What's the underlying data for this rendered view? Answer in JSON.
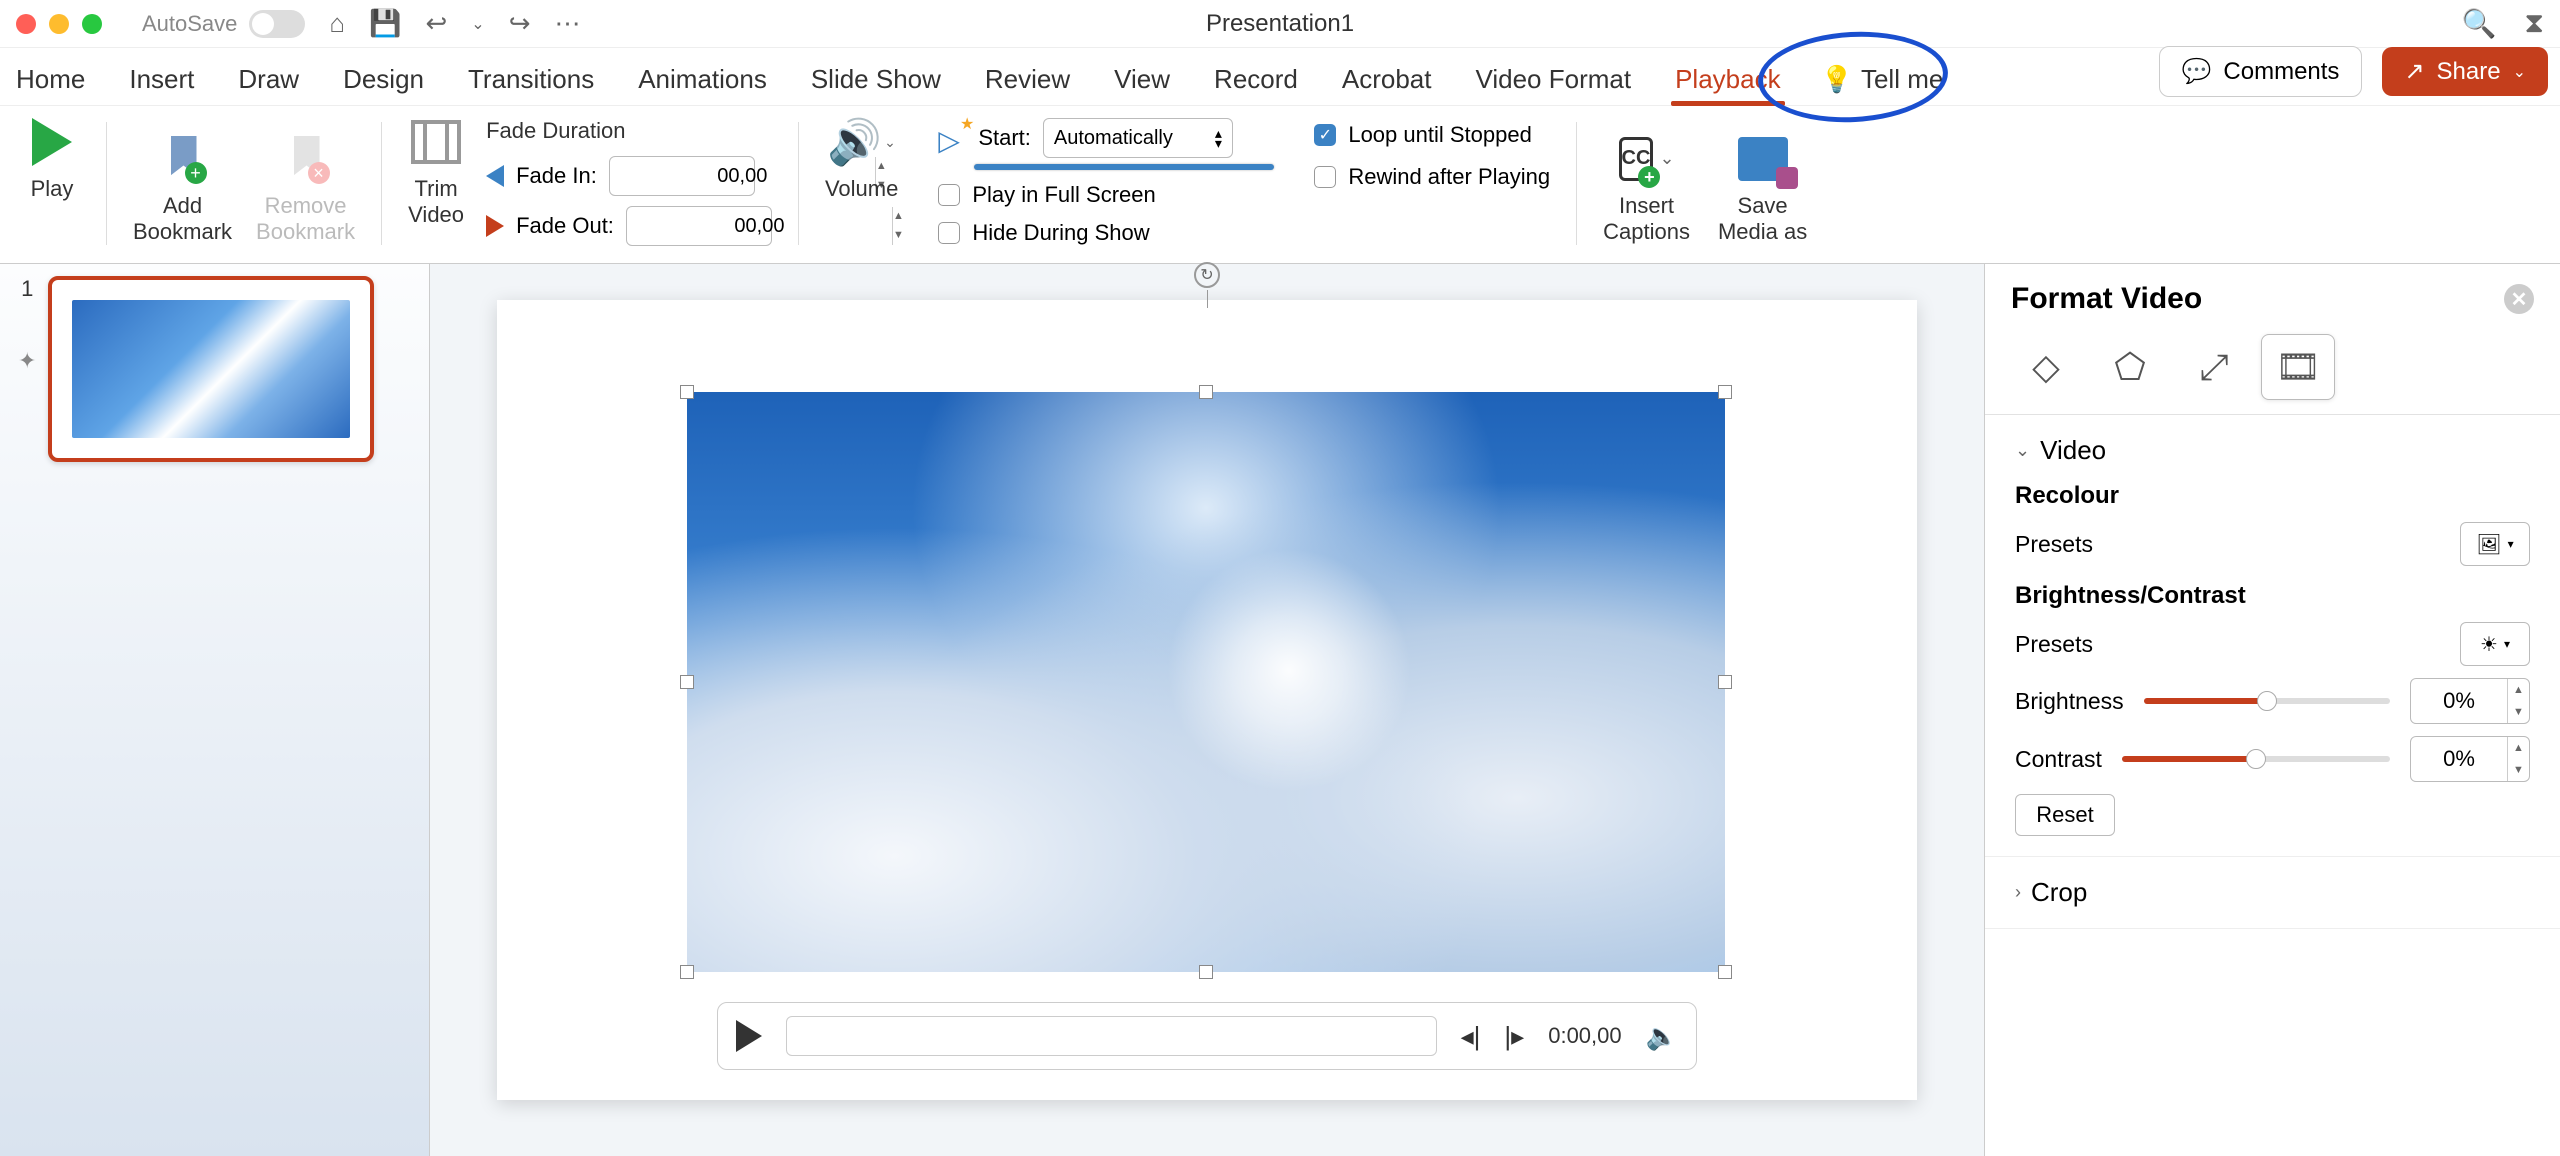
{
  "titlebar": {
    "autosave": "AutoSave",
    "title": "Presentation1"
  },
  "tabs": {
    "home": "Home",
    "insert": "Insert",
    "draw": "Draw",
    "design": "Design",
    "transitions": "Transitions",
    "animations": "Animations",
    "slideshow": "Slide Show",
    "review": "Review",
    "view": "View",
    "record": "Record",
    "acrobat": "Acrobat",
    "videoformat": "Video Format",
    "playback": "Playback",
    "tellme": "Tell me",
    "comments": "Comments",
    "share": "Share"
  },
  "ribbon": {
    "play": "Play",
    "add_bookmark": "Add\nBookmark",
    "remove_bookmark": "Remove\nBookmark",
    "trim_video": "Trim\nVideo",
    "fade_duration": "Fade Duration",
    "fade_in": "Fade In:",
    "fade_out": "Fade Out:",
    "fade_in_val": "00,00",
    "fade_out_val": "00,00",
    "volume": "Volume",
    "start": "Start:",
    "start_value": "Automatically",
    "play_full": "Play in Full Screen",
    "hide_during": "Hide During Show",
    "loop": "Loop until Stopped",
    "rewind": "Rewind after Playing",
    "insert_captions": "Insert\nCaptions",
    "save_media": "Save\nMedia as"
  },
  "thumb": {
    "num": "1"
  },
  "player": {
    "time": "0:00,00"
  },
  "pane": {
    "title": "Format Video",
    "video": "Video",
    "recolour": "Recolour",
    "presets": "Presets",
    "bc": "Brightness/Contrast",
    "brightness": "Brightness",
    "contrast": "Contrast",
    "brightness_val": "0%",
    "contrast_val": "0%",
    "reset": "Reset",
    "crop": "Crop"
  }
}
